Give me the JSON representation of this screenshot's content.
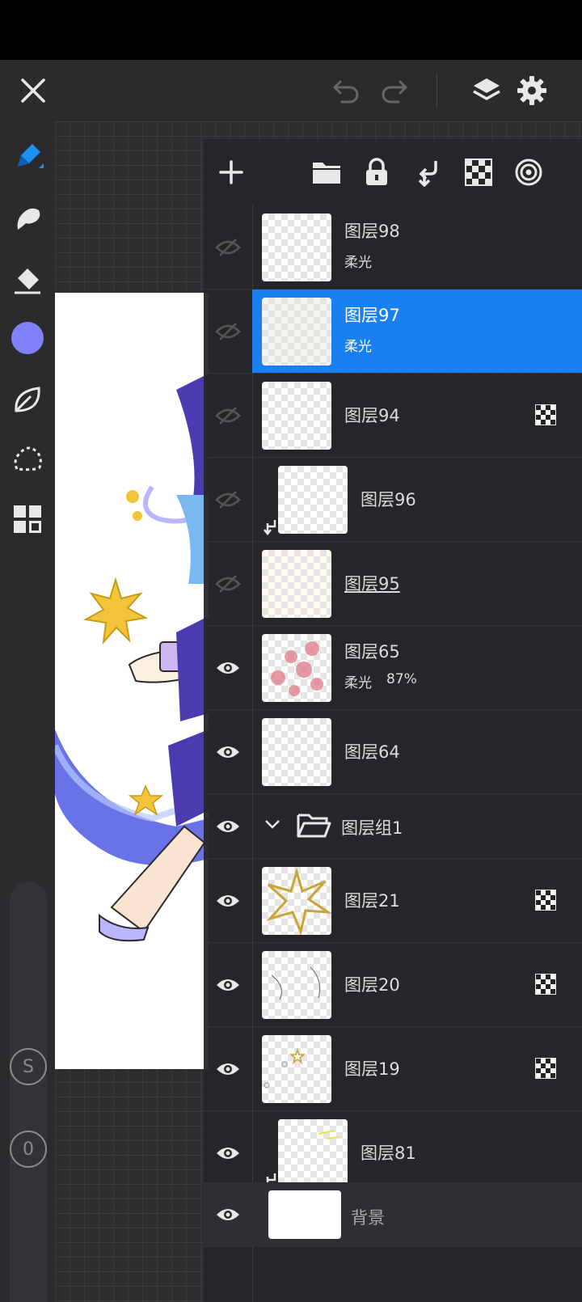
{
  "layers": [
    {
      "name": "图层98",
      "mode": "柔光",
      "visible": false,
      "selected": false
    },
    {
      "name": "图层97",
      "mode": "柔光",
      "visible": false,
      "selected": true
    },
    {
      "name": "图层94",
      "mode": "",
      "visible": false,
      "alpha_lock": true
    },
    {
      "name": "图层96",
      "mode": "",
      "visible": false,
      "clipped": true
    },
    {
      "name": "图层95",
      "mode": "",
      "visible": false
    },
    {
      "name": "图层65",
      "mode": "柔光",
      "opacity": "87%",
      "visible": true
    },
    {
      "name": "图层64",
      "mode": "",
      "visible": true
    },
    {
      "name": "图层组1",
      "group": true,
      "visible": true
    },
    {
      "name": "图层21",
      "mode": "",
      "visible": true,
      "alpha_lock": true
    },
    {
      "name": "图层20",
      "mode": "",
      "visible": true,
      "alpha_lock": true
    },
    {
      "name": "图层19",
      "mode": "",
      "visible": true,
      "alpha_lock": true
    },
    {
      "name": "图层81",
      "mode": "",
      "visible": true,
      "clipped": true
    }
  ],
  "background_layer": {
    "name": "背景"
  },
  "slider": {
    "s_label": "S",
    "o_label": "0"
  },
  "colors": {
    "accent": "#1a7ff0",
    "brush_color": "#8080f8",
    "active_tool": "#1e8ff0"
  },
  "icons": {
    "top": [
      "close-icon",
      "undo-icon",
      "redo-icon",
      "layers-icon",
      "settings-icon"
    ],
    "tools": [
      "pen-icon",
      "smudge-icon",
      "eraser-icon",
      "color-swatch",
      "leaf-icon",
      "lasso-icon",
      "grid-icon"
    ],
    "panel": [
      "add-icon",
      "folder-icon",
      "lock-icon",
      "merge-down-icon",
      "checker-icon",
      "blend-icon"
    ]
  }
}
